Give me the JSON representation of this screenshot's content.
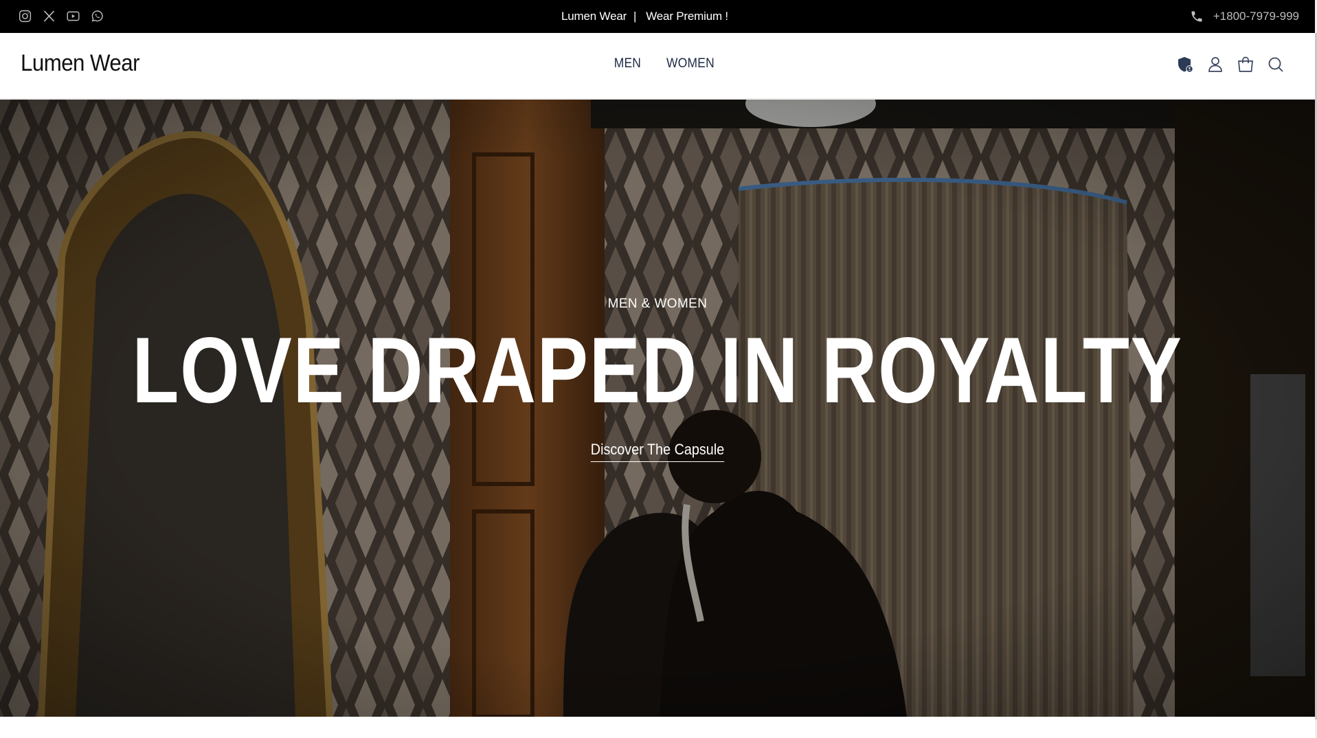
{
  "topbar": {
    "social_icons": [
      "instagram-icon",
      "x-twitter-icon",
      "youtube-icon",
      "whatsapp-icon"
    ],
    "brand": "Lumen Wear",
    "separator": "|",
    "tagline": "Wear Premium !",
    "phone": "+1800-7979-999",
    "bg_color": "#000000"
  },
  "header": {
    "logo": "Lumen Wear",
    "nav": [
      {
        "label": "MEN"
      },
      {
        "label": "WOMEN"
      }
    ],
    "icons": [
      "shield-account-icon",
      "user-icon",
      "shopping-bag-icon",
      "search-icon"
    ],
    "nav_color": "#1d2a44"
  },
  "hero": {
    "kicker": "MEN & WOMEN",
    "headline": "LOVE DRAPED IN ROYALTY",
    "cta": "Discover The Capsule"
  }
}
